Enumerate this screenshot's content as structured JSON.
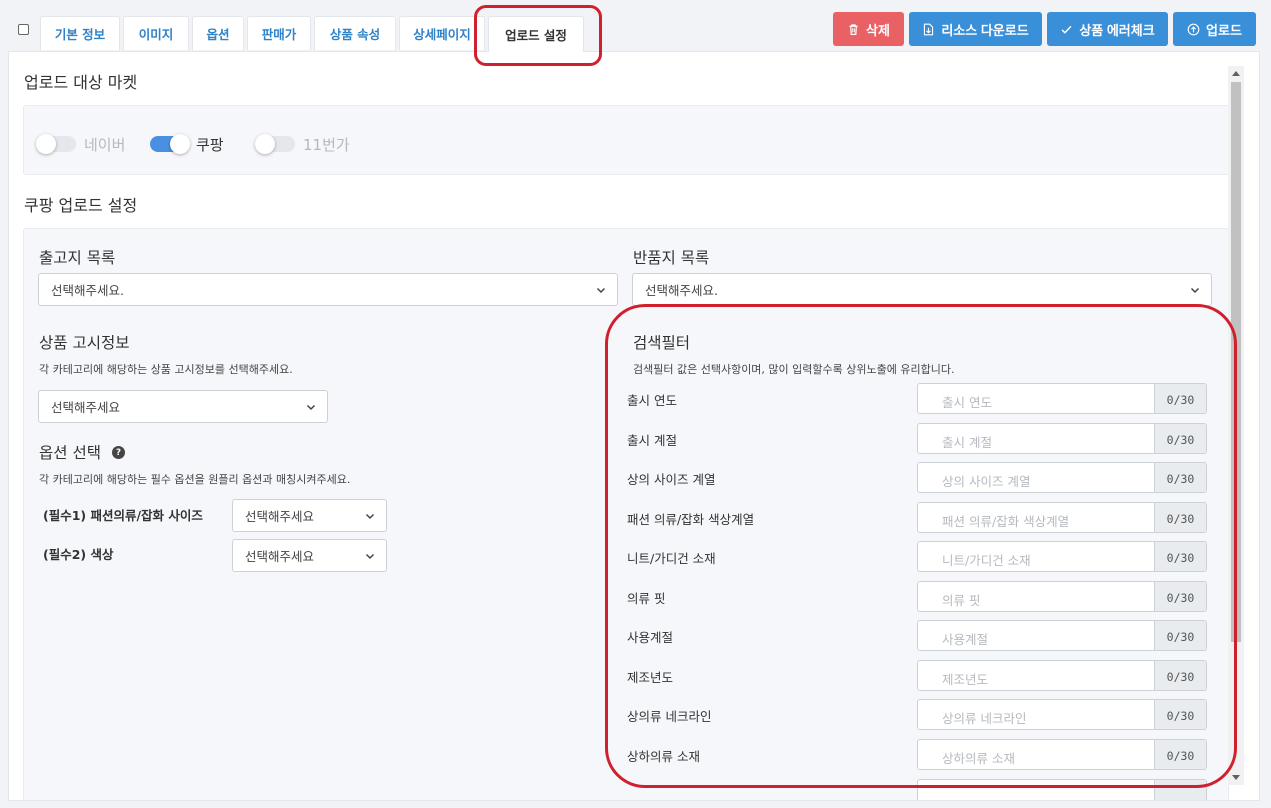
{
  "tabs": [
    {
      "label": "기본 정보"
    },
    {
      "label": "이미지"
    },
    {
      "label": "옵션"
    },
    {
      "label": "판매가"
    },
    {
      "label": "상품 속성"
    },
    {
      "label": "상세페이지"
    },
    {
      "label": "업로드 설정",
      "active": true
    }
  ],
  "actions": {
    "delete": "삭제",
    "resource_download": "리소스 다운로드",
    "error_check": "상품 에러체크",
    "upload": "업로드"
  },
  "upload_target": {
    "title": "업로드 대상 마켓",
    "markets": [
      {
        "name": "네이버",
        "enabled": false
      },
      {
        "name": "쿠팡",
        "enabled": true
      },
      {
        "name": "11번가",
        "enabled": false
      }
    ]
  },
  "coupang": {
    "title": "쿠팡 업로드 설정",
    "shipping_origin": {
      "label": "출고지 목록",
      "value": "선택해주세요."
    },
    "return_location": {
      "label": "반품지 목록",
      "value": "선택해주세요."
    },
    "notice_info": {
      "label": "상품 고시정보",
      "help": "각 카테고리에 해당하는 상품 고시정보를 선택해주세요.",
      "value": "선택해주세요"
    },
    "option_select": {
      "label": "옵션 선택",
      "help_icon": "?",
      "help": "각 카테고리에 해당하는 필수 옵션을 원플리 옵션과 매칭시켜주세요.",
      "items": [
        {
          "label": "(필수1) 패션의류/잡화 사이즈",
          "value": "선택해주세요"
        },
        {
          "label": "(필수2) 색상",
          "value": "선택해주세요"
        }
      ]
    },
    "search_filter": {
      "title": "검색필터",
      "help": "검색필터 값은 선택사항이며, 많이 입력할수록 상위노출에 유리합니다.",
      "fields": [
        {
          "label": "출시 연도",
          "placeholder": "출시 연도",
          "count": "0/30"
        },
        {
          "label": "출시 계절",
          "placeholder": "출시 계절",
          "count": "0/30"
        },
        {
          "label": "상의 사이즈 계열",
          "placeholder": "상의 사이즈 계열",
          "count": "0/30"
        },
        {
          "label": "패션 의류/잡화 색상계열",
          "placeholder": "패션 의류/잡화 색상계열",
          "count": "0/30"
        },
        {
          "label": "니트/가디건 소재",
          "placeholder": "니트/가디건 소재",
          "count": "0/30"
        },
        {
          "label": "의류 핏",
          "placeholder": "의류 핏",
          "count": "0/30"
        },
        {
          "label": "사용계절",
          "placeholder": "사용계절",
          "count": "0/30"
        },
        {
          "label": "제조년도",
          "placeholder": "제조년도",
          "count": "0/30"
        },
        {
          "label": "상의류 네크라인",
          "placeholder": "상의류 네크라인",
          "count": "0/30"
        },
        {
          "label": "상하의류 소재",
          "placeholder": "상하의류 소재",
          "count": "0/30"
        }
      ]
    }
  },
  "colors": {
    "accent_blue": "#3a8fd9",
    "danger": "#e96065",
    "highlight": "#d0202e"
  }
}
